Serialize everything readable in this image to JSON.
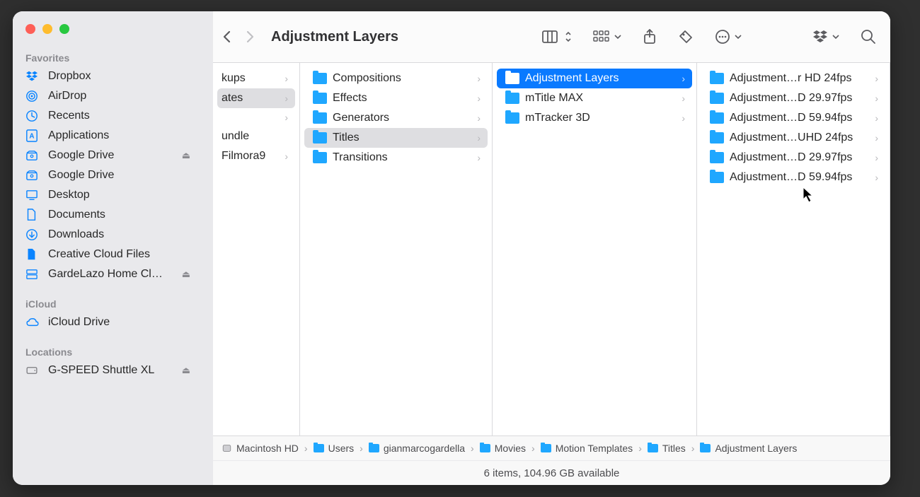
{
  "window": {
    "title": "Adjustment Layers"
  },
  "sidebar": {
    "sections": {
      "favorites": "Favorites",
      "icloud": "iCloud",
      "locations": "Locations"
    },
    "items": [
      {
        "label": "Dropbox",
        "icon": "dropbox"
      },
      {
        "label": "AirDrop",
        "icon": "airdrop"
      },
      {
        "label": "Recents",
        "icon": "recents"
      },
      {
        "label": "Applications",
        "icon": "apps"
      },
      {
        "label": "Google Drive",
        "icon": "gdrive",
        "eject": true
      },
      {
        "label": "Google Drive",
        "icon": "gdrive"
      },
      {
        "label": "Desktop",
        "icon": "desktop"
      },
      {
        "label": "Documents",
        "icon": "documents"
      },
      {
        "label": "Downloads",
        "icon": "downloads"
      },
      {
        "label": "Creative Cloud Files",
        "icon": "ccf"
      },
      {
        "label": "GardeLazo Home Cl…",
        "icon": "server",
        "eject": true
      }
    ],
    "icloud_items": [
      {
        "label": "iCloud Drive",
        "icon": "icloud"
      }
    ],
    "location_items": [
      {
        "label": "G-SPEED Shuttle XL",
        "icon": "drive",
        "eject": true
      }
    ]
  },
  "columns": {
    "c0": [
      {
        "label": "kups",
        "chev": true
      },
      {
        "label": "ates",
        "chev": true,
        "sel": "gray"
      },
      {
        "label": "",
        "chev": true
      },
      {
        "label": "undle"
      },
      {
        "label": "Filmora9",
        "chev": true
      }
    ],
    "c1": [
      {
        "label": "Compositions",
        "chev": true
      },
      {
        "label": "Effects",
        "chev": true
      },
      {
        "label": "Generators",
        "chev": true
      },
      {
        "label": "Titles",
        "chev": true,
        "sel": "gray"
      },
      {
        "label": "Transitions",
        "chev": true
      }
    ],
    "c2": [
      {
        "label": "Adjustment Layers",
        "chev": true,
        "sel": "blue"
      },
      {
        "label": "mTitle MAX",
        "chev": true
      },
      {
        "label": "mTracker 3D",
        "chev": true
      }
    ],
    "c3": [
      {
        "label": "Adjustment…r HD 24fps",
        "chev": true
      },
      {
        "label": "Adjustment…D 29.97fps",
        "chev": true
      },
      {
        "label": "Adjustment…D 59.94fps",
        "chev": true
      },
      {
        "label": "Adjustment…UHD 24fps",
        "chev": true
      },
      {
        "label": "Adjustment…D 29.97fps",
        "chev": true
      },
      {
        "label": "Adjustment…D 59.94fps",
        "chev": true
      }
    ]
  },
  "pathbar": [
    {
      "label": "Macintosh HD",
      "icon": "disk"
    },
    {
      "label": "Users"
    },
    {
      "label": "gianmarcogardella"
    },
    {
      "label": "Movies"
    },
    {
      "label": "Motion Templates"
    },
    {
      "label": "Titles"
    },
    {
      "label": "Adjustment Layers"
    }
  ],
  "statusbar": "6 items, 104.96 GB available"
}
